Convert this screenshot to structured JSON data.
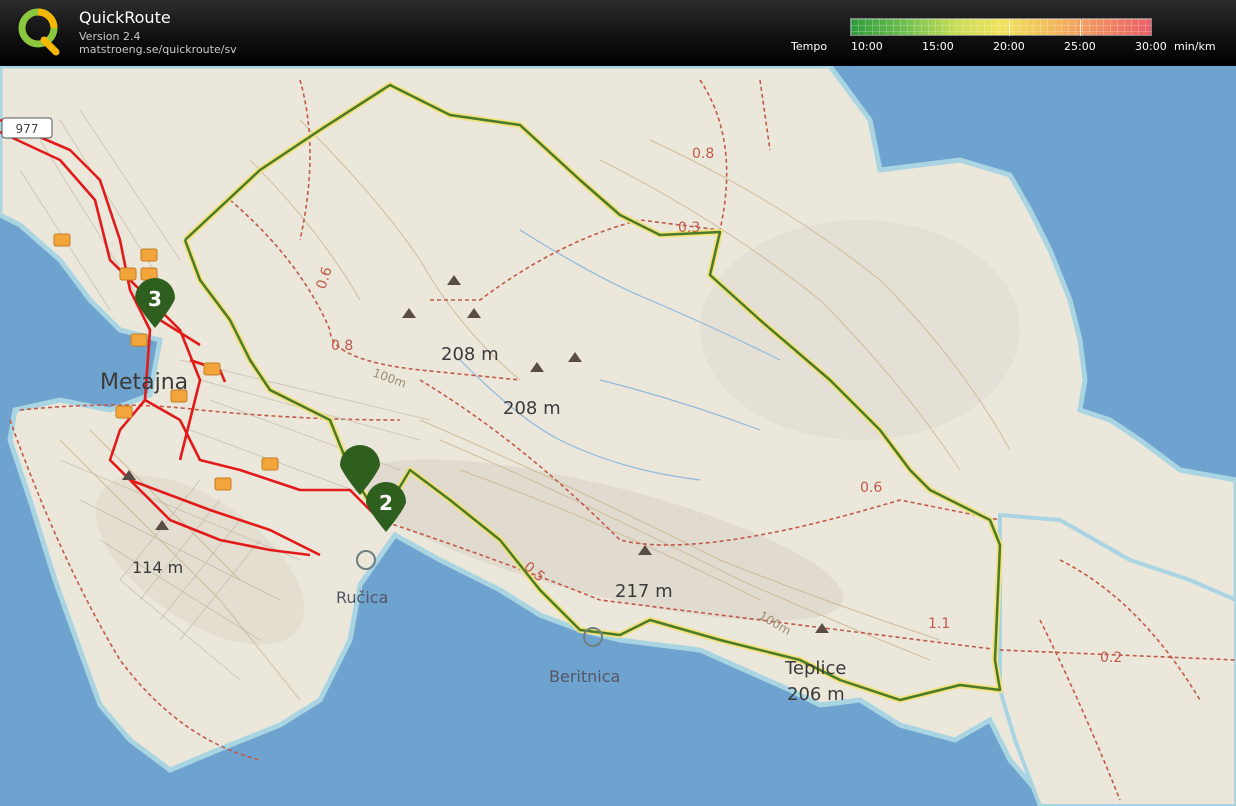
{
  "header": {
    "app_name": "QuickRoute",
    "version": "Version 2.4",
    "url": "matstroeng.se/quickroute/sv",
    "logo_letter": "Q"
  },
  "tempo_legend": {
    "label": "Tempo",
    "unit": "min/km",
    "ticks": [
      "10:00",
      "15:00",
      "20:00",
      "25:00",
      "30:00"
    ],
    "color_low": "#2e9a3c",
    "color_high": "#ea5e68"
  },
  "map": {
    "place_names": {
      "town": "Metajna",
      "bay_1": "Ručica",
      "bay_2": "Beritnica",
      "cove": "Teplice"
    },
    "elevations": {
      "peak_1": "208 m",
      "peak_2": "208 m",
      "peak_3": "217 m",
      "peak_4": "206 m",
      "peak_5": "114 m"
    },
    "distance_labels": [
      "0.8",
      "0.3",
      "0.6",
      "0.8",
      "0.5",
      "0.6",
      "1.1",
      "0.2",
      "100m",
      "100m"
    ],
    "road_badge": "977",
    "markers": [
      {
        "label": "3"
      },
      {
        "label": "2"
      },
      {
        "label": ""
      }
    ],
    "route_color": "#e21a1a",
    "track_color": "#4c7a2a",
    "water_color": "#6fa3cf",
    "land_color": "#ece7db"
  }
}
